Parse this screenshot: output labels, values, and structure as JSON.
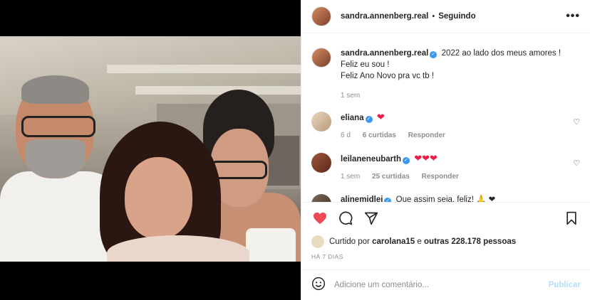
{
  "post": {
    "author": "sandra.annenberg.real",
    "dot": "•",
    "follow_state": "Seguindo",
    "more_glyph": "•••"
  },
  "caption": {
    "author": "sandra.annenberg.real",
    "line1": "2022 ao lado dos meus amores !",
    "line2": "Feliz eu sou !",
    "line3": "Feliz Ano Novo pra vc tb !",
    "time": "1 sem"
  },
  "comments": [
    {
      "user": "eliana",
      "text": "❤",
      "time": "6 d",
      "likes": "6 curtidas",
      "reply": "Responder"
    },
    {
      "user": "leilaneneubarth",
      "text": "❤❤❤",
      "time": "1 sem",
      "likes": "25 curtidas",
      "reply": "Responder"
    },
    {
      "user": "alinemidlej",
      "text": "Que assim seja, feliz! 🙏 ❤"
    }
  ],
  "likes": {
    "prefix": "Curtido por",
    "liker": "carolana15",
    "joiner": "e",
    "others": "outras 228.178 pessoas"
  },
  "date": "HÁ 7 DIAS",
  "add_comment": {
    "placeholder": "Adicione um comentário...",
    "publish": "Publicar"
  },
  "colors": {
    "like_red": "#ed4956",
    "verified_blue": "#3897f0",
    "publish_disabled": "#b2dffc"
  },
  "icons": [
    "more-icon",
    "heart-icon",
    "comment-icon",
    "share-icon",
    "bookmark-icon",
    "emoji-icon",
    "verified-icon"
  ]
}
